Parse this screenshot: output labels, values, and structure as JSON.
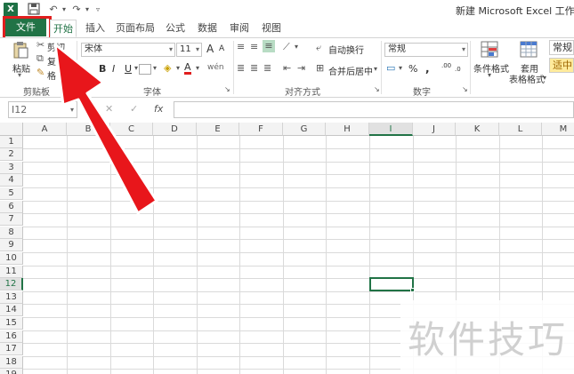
{
  "title_bar": {
    "logo_text": "X",
    "save_icon": "save-icon",
    "undo_icon": "undo-icon",
    "redo_icon": "redo-icon",
    "doc_title": "新建 Microsoft Excel 工作表 - E"
  },
  "tabs": {
    "file": "文件",
    "items": [
      "开始",
      "插入",
      "页面布局",
      "公式",
      "数据",
      "审阅",
      "视图"
    ],
    "active": "开始"
  },
  "ribbon": {
    "clipboard": {
      "paste": "粘贴",
      "cut": "剪切",
      "copy": "复",
      "format_painter": "格",
      "group_label": "剪贴板"
    },
    "font": {
      "font_name": "宋体",
      "font_size": "11",
      "grow": "A",
      "shrink": "A",
      "bold": "B",
      "italic": "I",
      "underline": "U",
      "font_color_glyph": "A",
      "phonetic": "wén",
      "group_label": "字体"
    },
    "alignment": {
      "wrap_text": "自动换行",
      "merge_center": "合并后居中",
      "group_label": "对齐方式"
    },
    "number": {
      "format": "常规",
      "percent": "%",
      "comma": ",",
      "inc_decimal": ".00",
      "dec_decimal": ".0",
      "group_label": "数字"
    },
    "styles": {
      "conditional_formatting": "条件格式",
      "format_as_table_line1": "套用",
      "format_as_table_line2": "表格格式",
      "normal_style": "常规",
      "neutral_style": "适中"
    }
  },
  "formula_bar": {
    "name_box": "I12",
    "cancel": "✕",
    "enter": "✓",
    "fx": "fx",
    "value": ""
  },
  "grid": {
    "columns": [
      "A",
      "B",
      "C",
      "D",
      "E",
      "F",
      "G",
      "H",
      "I",
      "J",
      "K",
      "L",
      "M"
    ],
    "rows": [
      "1",
      "2",
      "3",
      "4",
      "5",
      "6",
      "7",
      "8",
      "9",
      "10",
      "11",
      "12",
      "13",
      "14",
      "15",
      "16",
      "17",
      "18",
      "19"
    ],
    "selected_column": "I",
    "selected_row": "12"
  },
  "watermark": "软件技巧",
  "colors": {
    "excel_green": "#217346",
    "highlight_red": "#e01e1e",
    "arrow_red": "#e8161b"
  }
}
